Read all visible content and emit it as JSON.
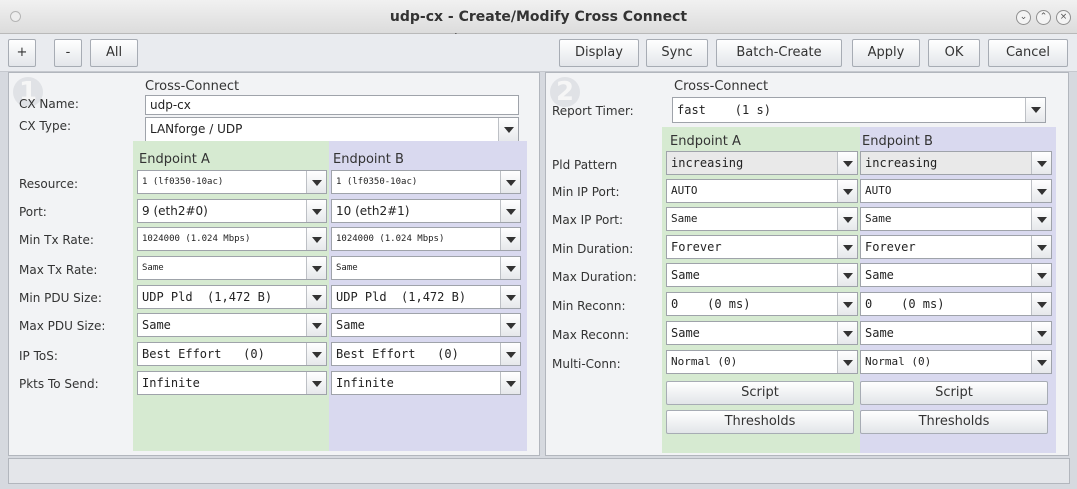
{
  "window": {
    "title": "udp-cx - Create/Modify Cross Connect"
  },
  "toolbar": {
    "plus_label": "+",
    "minus_label": "-",
    "all_label": "All",
    "display_label": "Display",
    "sync_label": "Sync",
    "batch_label": "Batch-Create",
    "apply_label": "Apply",
    "ok_label": "OK",
    "cancel_label": "Cancel"
  },
  "left": {
    "watermark": "1",
    "section_title": "Cross-Connect",
    "cx_name_label": "CX Name:",
    "cx_name_value": "udp-cx",
    "cx_type_label": "CX Type:",
    "cx_type_value": "LANforge / UDP",
    "endpoint_a": "Endpoint A",
    "endpoint_b": "Endpoint B",
    "rows": [
      {
        "label": "Resource:",
        "a": "1 (lf0350-10ac)",
        "b": "1 (lf0350-10ac)"
      },
      {
        "label": "Port:",
        "a": "9 (eth2#0)",
        "b": "10 (eth2#1)"
      },
      {
        "label": "Min Tx Rate:",
        "a": "1024000 (1.024 Mbps)",
        "b": "1024000 (1.024 Mbps)"
      },
      {
        "label": "Max Tx Rate:",
        "a": "Same",
        "b": "Same"
      },
      {
        "label": "Min PDU Size:",
        "a": "UDP Pld  (1,472 B)",
        "b": "UDP Pld  (1,472 B)"
      },
      {
        "label": "Max PDU Size:",
        "a": "Same",
        "b": "Same"
      },
      {
        "label": "IP ToS:",
        "a": "Best Effort   (0)",
        "b": "Best Effort   (0)"
      },
      {
        "label": "Pkts To Send:",
        "a": "Infinite",
        "b": "Infinite"
      }
    ]
  },
  "right": {
    "watermark": "2",
    "section_title": "Cross-Connect",
    "report_timer_label": "Report Timer:",
    "report_timer_value": "fast    (1 s)",
    "endpoint_a": "Endpoint A",
    "endpoint_b": "Endpoint B",
    "rows": [
      {
        "label": "Pld Pattern",
        "a": "increasing",
        "b": "increasing"
      },
      {
        "label": "Min IP Port:",
        "a": "AUTO",
        "b": "AUTO"
      },
      {
        "label": "Max IP Port:",
        "a": "Same",
        "b": "Same"
      },
      {
        "label": "Min Duration:",
        "a": "Forever",
        "b": "Forever"
      },
      {
        "label": "Max Duration:",
        "a": "Same",
        "b": "Same"
      },
      {
        "label": "Min Reconn:",
        "a": "0    (0 ms)",
        "b": "0    (0 ms)"
      },
      {
        "label": "Max Reconn:",
        "a": "Same",
        "b": "Same"
      },
      {
        "label": "Multi-Conn:",
        "a": "Normal (0)",
        "b": "Normal (0)"
      }
    ],
    "script_label": "Script",
    "thresholds_label": "Thresholds"
  }
}
